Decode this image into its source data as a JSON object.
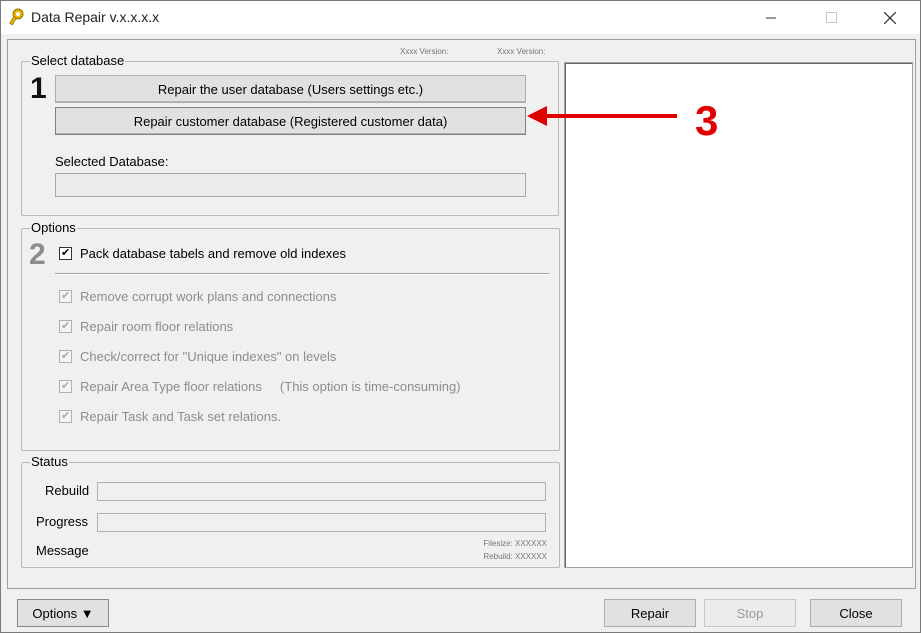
{
  "window": {
    "title": "Data Repair v.x.x.x.x",
    "minimize": "—",
    "maximize": "☐",
    "close": "✕"
  },
  "header": {
    "version1": "Xxxx Version:",
    "version2": "Xxxx Version:"
  },
  "select_database": {
    "legend": "Select database",
    "step": "1",
    "btn_user": "Repair the user database  (Users settings etc.)",
    "btn_customer": "Repair customer database  (Registered customer data)",
    "selected_label": "Selected Database:",
    "selected_value": ""
  },
  "options": {
    "legend": "Options",
    "step": "2",
    "main_check": {
      "label": "Pack database tabels and remove old indexes",
      "checked": true
    },
    "items": [
      {
        "label": "Remove corrupt work plans and connections",
        "checked": true,
        "enabled": false
      },
      {
        "label": "Repair room floor relations",
        "checked": true,
        "enabled": false
      },
      {
        "label": "Check/correct for \"Unique indexes\" on levels",
        "checked": true,
        "enabled": false
      },
      {
        "label": "Repair Area Type floor relations     (This option is time-consuming)",
        "checked": true,
        "enabled": false
      },
      {
        "label": "Repair Task and Task set relations.",
        "checked": true,
        "enabled": false
      }
    ]
  },
  "status": {
    "legend": "Status",
    "rebuild_label": "Rebuild",
    "progress_label": "Progress",
    "message_label": "Message",
    "filesize": "Filesize: XXXXXX",
    "rebuild_info": "Rebuild: XXXXXX"
  },
  "buttons": {
    "options": "Options ▼",
    "repair": "Repair",
    "stop": "Stop",
    "close": "Close"
  },
  "annotation": {
    "number": "3",
    "color": "#e10000"
  }
}
